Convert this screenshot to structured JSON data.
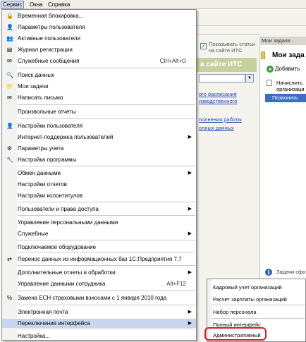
{
  "menubar": {
    "items": [
      "Сервис",
      "Окна",
      "Справка"
    ]
  },
  "background": {
    "show_articles_label": "Показывать статьи на сайте ИТС",
    "itc_banner": "а сайте ИТС",
    "link_1": "ого расписания",
    "link_2": "изводственного",
    "link_3": "полнения работы",
    "link_4": "олных данных",
    "tasks_header": "Мои задачи",
    "tasks_title": "Мои зада",
    "add_label": "Добавить",
    "task_1": "Начислить организаци",
    "task_2": "Позвонить",
    "info_text": "Задачи сфо"
  },
  "menu": {
    "items": [
      {
        "label": "Временная блокировка...",
        "icon": "lock-icon",
        "glyph": "🔒"
      },
      {
        "label": "Параметры пользователя",
        "icon": "user-settings-icon",
        "glyph": "👤"
      },
      {
        "label": "Активные пользователи",
        "icon": "users-icon",
        "glyph": "👥"
      },
      {
        "label": "Журнал регистрации",
        "icon": "log-icon",
        "glyph": "▤"
      },
      {
        "label": "Служебные сообщения",
        "icon": "messages-icon",
        "glyph": "✉",
        "shortcut": "Ctrl+Alt+O"
      },
      {
        "label": "Поиск данных",
        "icon": "search-icon",
        "glyph": "🔍"
      },
      {
        "label": "Мои задачи",
        "icon": "tasks-icon",
        "glyph": "📁"
      },
      {
        "label": "Написать письмо",
        "icon": "mail-icon",
        "glyph": "✉"
      },
      {
        "label": "Произвольные отчеты",
        "icon": "",
        "glyph": ""
      },
      {
        "label": "Настройки пользователя",
        "icon": "user-icon",
        "glyph": "👤"
      },
      {
        "label": "Интернет-поддержка пользователей",
        "icon": "",
        "glyph": "",
        "submenu": true
      },
      {
        "label": "Параметры учета",
        "icon": "accounting-icon",
        "glyph": "⚙"
      },
      {
        "label": "Настройка программы",
        "icon": "program-settings-icon",
        "glyph": "🔧"
      },
      {
        "label": "Обмен данными",
        "icon": "",
        "glyph": "",
        "submenu": true
      },
      {
        "label": "Настройки отчетов",
        "icon": "",
        "glyph": ""
      },
      {
        "label": "Настройки колонтитулов",
        "icon": "",
        "glyph": ""
      },
      {
        "label": "Пользователи и права доступа",
        "icon": "",
        "glyph": "",
        "submenu": true
      },
      {
        "label": "Управление персональными данными",
        "icon": "",
        "glyph": ""
      },
      {
        "label": "Служебные",
        "icon": "",
        "glyph": "",
        "submenu": true
      },
      {
        "label": "Подключаемое оборудование",
        "icon": "",
        "glyph": ""
      },
      {
        "label": "Перенос данных из информационных баз 1С:Предприятия 7.7",
        "icon": "transfer-icon",
        "glyph": "⇄"
      },
      {
        "label": "Дополнительные отчеты и обработки",
        "icon": "",
        "glyph": "",
        "submenu": true
      },
      {
        "label": "Управление данными сотрудника",
        "icon": "",
        "glyph": "",
        "shortcut": "Alt+F12"
      },
      {
        "label": "Замена ЕСН страховыми взносами с 1 января 2010 года",
        "icon": "esn-icon",
        "glyph": "%"
      },
      {
        "label": "Электронная почта",
        "icon": "",
        "glyph": "",
        "submenu": true
      },
      {
        "label": "Переключение интерфейса",
        "icon": "",
        "glyph": "",
        "submenu": true
      },
      {
        "label": "Настройка...",
        "icon": "",
        "glyph": ""
      }
    ]
  },
  "submenu": {
    "items": [
      {
        "label": "Кадровый учет организаций"
      },
      {
        "label": "Расчет зарплаты организаций"
      },
      {
        "label": "Набор персонала"
      },
      {
        "label": "Полный интерфейс"
      },
      {
        "label": "Административный"
      }
    ]
  }
}
